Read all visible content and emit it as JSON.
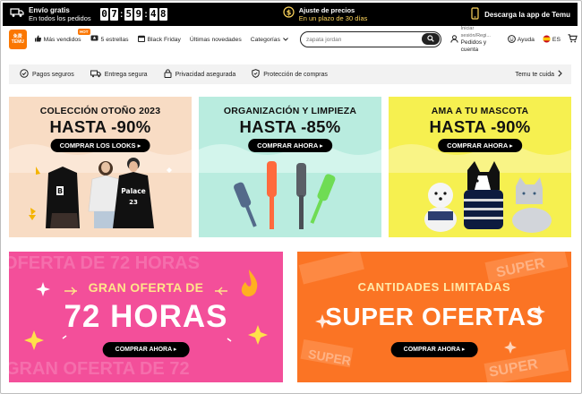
{
  "topbar": {
    "shipping_title": "Envío gratis",
    "shipping_sub": "En todos los pedidos",
    "countdown": [
      "0",
      "7",
      "5",
      "9",
      "4",
      "8"
    ],
    "price_title": "Ajuste de precios",
    "price_sub": "En un plazo de 30 días",
    "app_label": "Descarga la app de Temu"
  },
  "header": {
    "logo_top": "免费",
    "logo_bottom": "TEMU",
    "nav": [
      {
        "label": "Más vendidos",
        "badge": "HOT"
      },
      {
        "label": "5 estrellas"
      },
      {
        "label": "Black Friday"
      },
      {
        "label": "Últimas novedades"
      },
      {
        "label": "Categorías"
      }
    ],
    "search_placeholder": "zapata jordan",
    "account_line1": "Iniciar sesión/Regi...",
    "account_line2": "Pedidos y cuenta",
    "help_label": "Ayuda",
    "lang_label": "ES"
  },
  "trust": {
    "items": [
      "Pagos seguros",
      "Entrega segura",
      "Privacidad asegurada",
      "Protección de compras"
    ],
    "right_label": "Temu te cuida"
  },
  "cards": {
    "fashion": {
      "sub": "COLECCIÓN OTOÑO 2023",
      "big": "HASTA -90%",
      "cta": "COMPRAR LOS LOOKS"
    },
    "cleaning": {
      "sub": "ORGANIZACIÓN Y LIMPIEZA",
      "big": "HASTA -85%",
      "cta": "COMPRAR AHORA"
    },
    "pets": {
      "sub": "AMA A TU MASCOTA",
      "big": "HASTA -90%",
      "cta": "COMPRAR AHORA"
    },
    "flash": {
      "ghost_top": "OFERTA DE 72 HORAS",
      "top": "GRAN OFERTA DE",
      "big": "72 HORAS",
      "cta": "COMPRAR AHORA",
      "ghost_bottom": "GRAN OFERTA DE 72"
    },
    "limited": {
      "top": "CANTIDADES LIMITADAS",
      "big": "SUPER OFERTAS",
      "cta": "COMPRAR AHORA",
      "stamp": "SUPER"
    }
  },
  "colors": {
    "brand_orange": "#fb7701",
    "pink": "#f34f9a",
    "orange": "#fb7424"
  }
}
